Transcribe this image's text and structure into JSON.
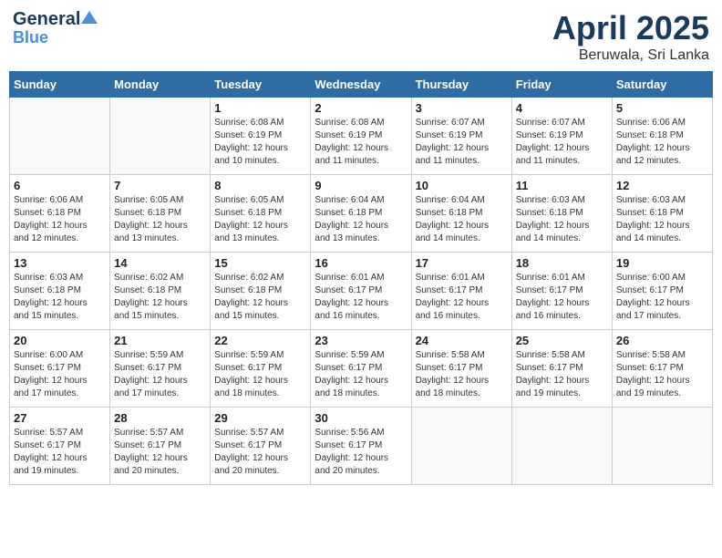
{
  "header": {
    "logo_line1": "General",
    "logo_line2": "Blue",
    "title": "April 2025",
    "subtitle": "Beruwala, Sri Lanka"
  },
  "calendar": {
    "days_of_week": [
      "Sunday",
      "Monday",
      "Tuesday",
      "Wednesday",
      "Thursday",
      "Friday",
      "Saturday"
    ],
    "weeks": [
      [
        {
          "day": "",
          "info": ""
        },
        {
          "day": "",
          "info": ""
        },
        {
          "day": "1",
          "info": "Sunrise: 6:08 AM\nSunset: 6:19 PM\nDaylight: 12 hours\nand 10 minutes."
        },
        {
          "day": "2",
          "info": "Sunrise: 6:08 AM\nSunset: 6:19 PM\nDaylight: 12 hours\nand 11 minutes."
        },
        {
          "day": "3",
          "info": "Sunrise: 6:07 AM\nSunset: 6:19 PM\nDaylight: 12 hours\nand 11 minutes."
        },
        {
          "day": "4",
          "info": "Sunrise: 6:07 AM\nSunset: 6:19 PM\nDaylight: 12 hours\nand 11 minutes."
        },
        {
          "day": "5",
          "info": "Sunrise: 6:06 AM\nSunset: 6:18 PM\nDaylight: 12 hours\nand 12 minutes."
        }
      ],
      [
        {
          "day": "6",
          "info": "Sunrise: 6:06 AM\nSunset: 6:18 PM\nDaylight: 12 hours\nand 12 minutes."
        },
        {
          "day": "7",
          "info": "Sunrise: 6:05 AM\nSunset: 6:18 PM\nDaylight: 12 hours\nand 13 minutes."
        },
        {
          "day": "8",
          "info": "Sunrise: 6:05 AM\nSunset: 6:18 PM\nDaylight: 12 hours\nand 13 minutes."
        },
        {
          "day": "9",
          "info": "Sunrise: 6:04 AM\nSunset: 6:18 PM\nDaylight: 12 hours\nand 13 minutes."
        },
        {
          "day": "10",
          "info": "Sunrise: 6:04 AM\nSunset: 6:18 PM\nDaylight: 12 hours\nand 14 minutes."
        },
        {
          "day": "11",
          "info": "Sunrise: 6:03 AM\nSunset: 6:18 PM\nDaylight: 12 hours\nand 14 minutes."
        },
        {
          "day": "12",
          "info": "Sunrise: 6:03 AM\nSunset: 6:18 PM\nDaylight: 12 hours\nand 14 minutes."
        }
      ],
      [
        {
          "day": "13",
          "info": "Sunrise: 6:03 AM\nSunset: 6:18 PM\nDaylight: 12 hours\nand 15 minutes."
        },
        {
          "day": "14",
          "info": "Sunrise: 6:02 AM\nSunset: 6:18 PM\nDaylight: 12 hours\nand 15 minutes."
        },
        {
          "day": "15",
          "info": "Sunrise: 6:02 AM\nSunset: 6:18 PM\nDaylight: 12 hours\nand 15 minutes."
        },
        {
          "day": "16",
          "info": "Sunrise: 6:01 AM\nSunset: 6:17 PM\nDaylight: 12 hours\nand 16 minutes."
        },
        {
          "day": "17",
          "info": "Sunrise: 6:01 AM\nSunset: 6:17 PM\nDaylight: 12 hours\nand 16 minutes."
        },
        {
          "day": "18",
          "info": "Sunrise: 6:01 AM\nSunset: 6:17 PM\nDaylight: 12 hours\nand 16 minutes."
        },
        {
          "day": "19",
          "info": "Sunrise: 6:00 AM\nSunset: 6:17 PM\nDaylight: 12 hours\nand 17 minutes."
        }
      ],
      [
        {
          "day": "20",
          "info": "Sunrise: 6:00 AM\nSunset: 6:17 PM\nDaylight: 12 hours\nand 17 minutes."
        },
        {
          "day": "21",
          "info": "Sunrise: 5:59 AM\nSunset: 6:17 PM\nDaylight: 12 hours\nand 17 minutes."
        },
        {
          "day": "22",
          "info": "Sunrise: 5:59 AM\nSunset: 6:17 PM\nDaylight: 12 hours\nand 18 minutes."
        },
        {
          "day": "23",
          "info": "Sunrise: 5:59 AM\nSunset: 6:17 PM\nDaylight: 12 hours\nand 18 minutes."
        },
        {
          "day": "24",
          "info": "Sunrise: 5:58 AM\nSunset: 6:17 PM\nDaylight: 12 hours\nand 18 minutes."
        },
        {
          "day": "25",
          "info": "Sunrise: 5:58 AM\nSunset: 6:17 PM\nDaylight: 12 hours\nand 19 minutes."
        },
        {
          "day": "26",
          "info": "Sunrise: 5:58 AM\nSunset: 6:17 PM\nDaylight: 12 hours\nand 19 minutes."
        }
      ],
      [
        {
          "day": "27",
          "info": "Sunrise: 5:57 AM\nSunset: 6:17 PM\nDaylight: 12 hours\nand 19 minutes."
        },
        {
          "day": "28",
          "info": "Sunrise: 5:57 AM\nSunset: 6:17 PM\nDaylight: 12 hours\nand 20 minutes."
        },
        {
          "day": "29",
          "info": "Sunrise: 5:57 AM\nSunset: 6:17 PM\nDaylight: 12 hours\nand 20 minutes."
        },
        {
          "day": "30",
          "info": "Sunrise: 5:56 AM\nSunset: 6:17 PM\nDaylight: 12 hours\nand 20 minutes."
        },
        {
          "day": "",
          "info": ""
        },
        {
          "day": "",
          "info": ""
        },
        {
          "day": "",
          "info": ""
        }
      ]
    ]
  }
}
